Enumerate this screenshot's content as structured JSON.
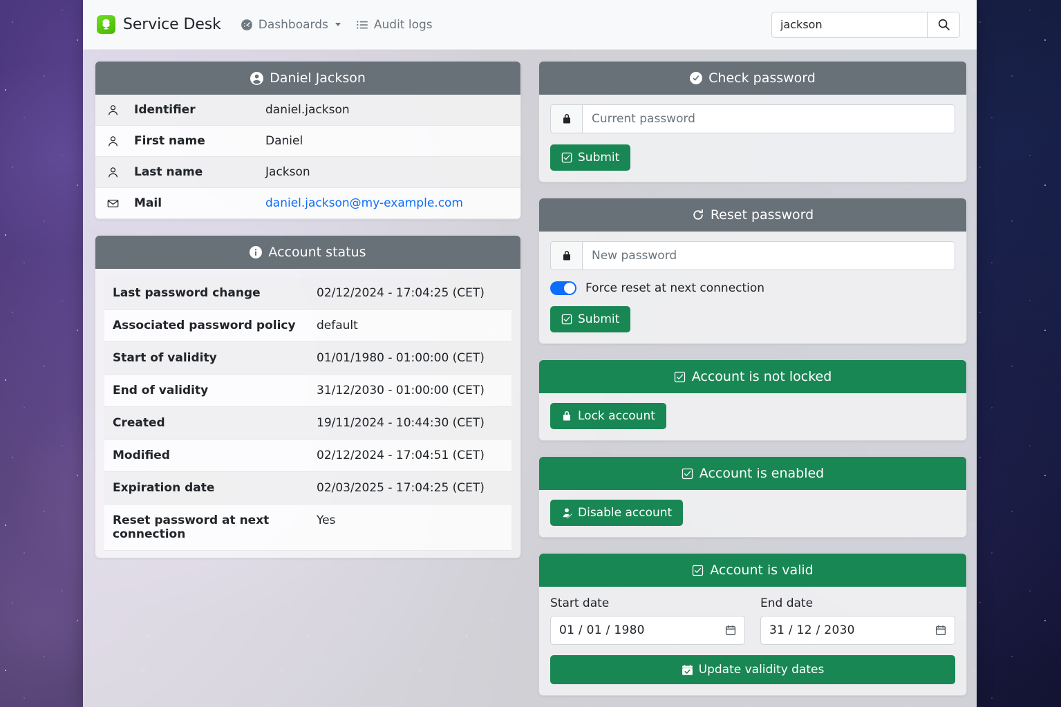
{
  "navbar": {
    "brand": "Service Desk",
    "logo_icon": "tree-logo-icon",
    "links": [
      {
        "label": "Dashboards",
        "icon": "speedometer-icon",
        "has_caret": true
      },
      {
        "label": "Audit logs",
        "icon": "list-icon",
        "has_caret": false
      }
    ],
    "search": {
      "value": "jackson",
      "placeholder": "",
      "button_icon": "search-icon"
    }
  },
  "identity_card": {
    "title": "Daniel Jackson",
    "title_icon": "person-circle-icon",
    "rows": [
      {
        "icon": "person-icon",
        "label": "Identifier",
        "value": "daniel.jackson",
        "is_link": false
      },
      {
        "icon": "person-icon",
        "label": "First name",
        "value": "Daniel",
        "is_link": false
      },
      {
        "icon": "person-icon",
        "label": "Last name",
        "value": "Jackson",
        "is_link": false
      },
      {
        "icon": "envelope-icon",
        "label": "Mail",
        "value": "daniel.jackson@my-example.com",
        "is_link": true
      }
    ]
  },
  "account_status_card": {
    "title": "Account status",
    "title_icon": "info-circle-icon",
    "rows": [
      {
        "key": "Last password change",
        "value": "02/12/2024 - 17:04:25 (CET)"
      },
      {
        "key": "Associated password policy",
        "value": "default"
      },
      {
        "key": "Start of validity",
        "value": "01/01/1980 - 01:00:00 (CET)"
      },
      {
        "key": "End of validity",
        "value": "31/12/2030 - 01:00:00 (CET)"
      },
      {
        "key": "Created",
        "value": "19/11/2024 - 10:44:30 (CET)"
      },
      {
        "key": "Modified",
        "value": "02/12/2024 - 17:04:51 (CET)"
      },
      {
        "key": "Expiration date",
        "value": "02/03/2025 - 17:04:25 (CET)"
      },
      {
        "key": "Reset password at next connection",
        "value": "Yes"
      }
    ]
  },
  "check_password_card": {
    "title": "Check password",
    "title_icon": "check-circle-icon",
    "password_placeholder": "Current password",
    "password_value": "",
    "lock_icon": "lock-icon",
    "submit_label": "Submit",
    "submit_icon": "check-square-icon"
  },
  "reset_password_card": {
    "title": "Reset password",
    "title_icon": "arrow-clockwise-icon",
    "password_placeholder": "New password",
    "password_value": "",
    "lock_icon": "lock-icon",
    "toggle_label": "Force reset at next connection",
    "toggle_on": true,
    "submit_label": "Submit",
    "submit_icon": "check-square-icon"
  },
  "lock_card": {
    "title": "Account is not locked",
    "title_icon": "check-square-icon",
    "button_label": "Lock account",
    "button_icon": "lock-fill-icon"
  },
  "enable_card": {
    "title": "Account is enabled",
    "title_icon": "check-square-icon",
    "button_label": "Disable account",
    "button_icon": "person-slash-icon"
  },
  "validity_card": {
    "title": "Account is valid",
    "title_icon": "check-square-icon",
    "start_label": "Start date",
    "start_value": "01 / 01 / 1980",
    "end_label": "End date",
    "end_value": "31 / 12 / 2030",
    "calendar_icon": "calendar-icon",
    "update_label": "Update validity dates",
    "update_icon": "calendar-check-icon"
  },
  "colors": {
    "header_gray": "#687078",
    "success_green": "#198754",
    "link_blue": "#0d6efd",
    "toggle_blue": "#0d6efd",
    "brand_green": "#58c90f"
  }
}
